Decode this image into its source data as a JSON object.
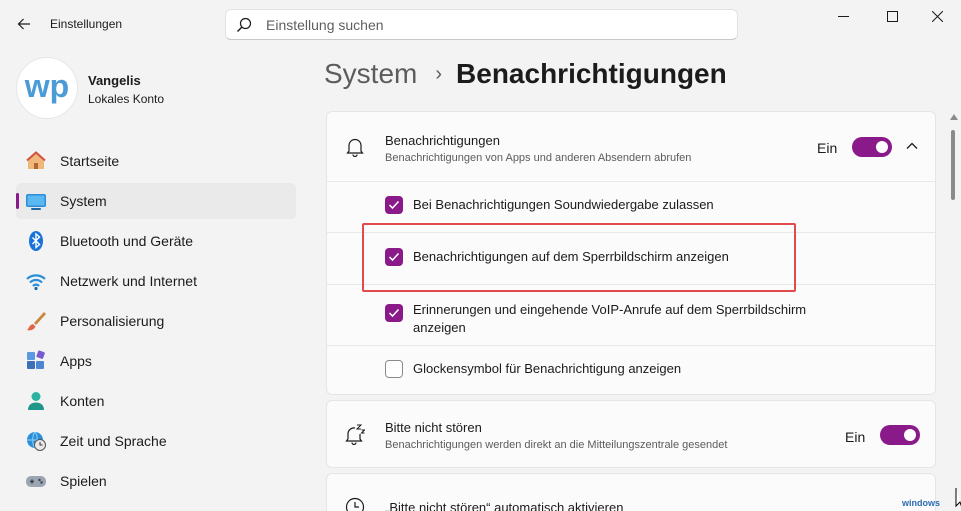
{
  "window": {
    "title": "Einstellungen",
    "controls": [
      "minimize",
      "maximize",
      "close"
    ]
  },
  "search": {
    "placeholder": "Einstellung suchen",
    "value": ""
  },
  "profile": {
    "logo_text": "wp",
    "name": "Vangelis",
    "account_type": "Lokales Konto"
  },
  "sidebar": {
    "items": [
      {
        "label": "Startseite",
        "icon": "home-icon",
        "active": false
      },
      {
        "label": "System",
        "icon": "monitor-icon",
        "active": true
      },
      {
        "label": "Bluetooth und Geräte",
        "icon": "bluetooth-icon",
        "active": false
      },
      {
        "label": "Netzwerk und Internet",
        "icon": "wifi-icon",
        "active": false
      },
      {
        "label": "Personalisierung",
        "icon": "brush-icon",
        "active": false
      },
      {
        "label": "Apps",
        "icon": "apps-icon",
        "active": false
      },
      {
        "label": "Konten",
        "icon": "person-icon",
        "active": false
      },
      {
        "label": "Zeit und Sprache",
        "icon": "globe-clock-icon",
        "active": false
      },
      {
        "label": "Spielen",
        "icon": "gamepad-icon",
        "active": false
      }
    ]
  },
  "breadcrumb": {
    "parent": "System",
    "separator": "›",
    "current": "Benachrichtigungen"
  },
  "notifications": {
    "title": "Benachrichtigungen",
    "subtitle": "Benachrichtigungen von Apps und anderen Absendern abrufen",
    "toggle_label": "Ein",
    "toggle_on": true,
    "options": [
      {
        "label": "Bei Benachrichtigungen Soundwiedergabe zulassen",
        "checked": true
      },
      {
        "label": "Benachrichtigungen auf dem Sperrbildschirm anzeigen",
        "checked": true
      },
      {
        "label": "Erinnerungen und eingehende VoIP-Anrufe auf dem Sperrbildschirm anzeigen",
        "checked": true
      },
      {
        "label": "Glockensymbol für Benachrichtigung anzeigen",
        "checked": false
      }
    ]
  },
  "dnd": {
    "title": "Bitte nicht stören",
    "subtitle": "Benachrichtigungen werden direkt an die Mitteilungszentrale gesendet",
    "toggle_label": "Ein",
    "toggle_on": true
  },
  "auto_dnd": {
    "title": "„Bitte nicht stören“ automatisch aktivieren"
  },
  "watermark": "windows",
  "colors": {
    "accent": "#8a1a8a",
    "highlight": "#e14b4b",
    "background": "#f3f3f3"
  }
}
